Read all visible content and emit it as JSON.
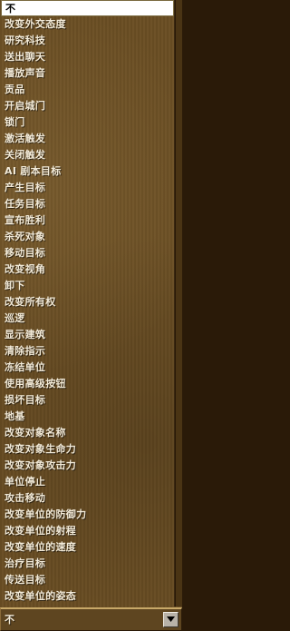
{
  "dropdown": {
    "items": [
      "不",
      "改变外交态度",
      "研究科技",
      "送出聊天",
      "播放声音",
      "贡品",
      "开启城门",
      "锁门",
      "激活触发",
      "关闭触发",
      "AI 剧本目标",
      "产生目标",
      "任务目标",
      "宣布胜利",
      "杀死对象",
      "移动目标",
      "改变视角",
      "卸下",
      "改变所有权",
      "巡逻",
      "显示建筑",
      "清除指示",
      "冻结单位",
      "使用高级按钮",
      "损坏目标",
      "地基",
      "改变对象名称",
      "改变对象生命力",
      "改变对象攻击力",
      "单位停止",
      "攻击移动",
      "改变单位的防御力",
      "改变单位的射程",
      "改变单位的速度",
      "治疗目标",
      "传送目标",
      "改变单位的姿态"
    ],
    "selected_index": 0
  },
  "combo": {
    "value": "不",
    "arrow_icon": "chevron-down-icon"
  }
}
